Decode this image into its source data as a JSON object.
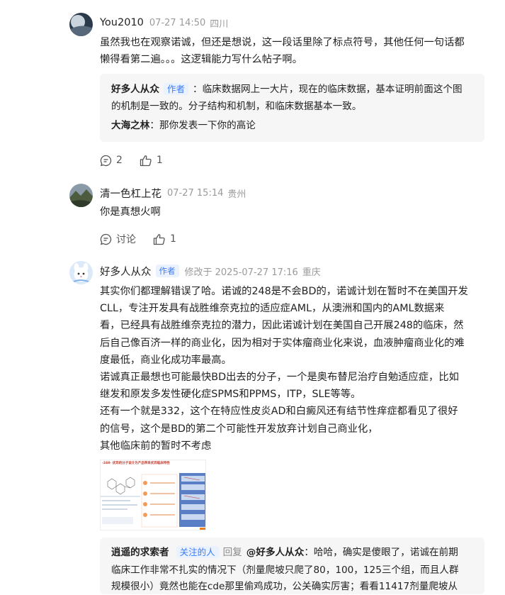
{
  "comments": [
    {
      "username": "You2010",
      "time": "07-27 14:50",
      "location": "四川",
      "text_lines": [
        "虽然我也在观察诺诚，但还是想说，这一段话里除了标点符号，其他任何一句话都",
        "懒得看第二遍。。。这逻辑能力写什么帖子啊。"
      ],
      "replies": [
        {
          "name": "好多人从众",
          "badge": "作者",
          "lines": [
            "：临床数据网上一大片，现在的临床数据，基本证明前面这个图",
            "的机制是一致的。分子结构和机制，和临床数据基本一致。"
          ]
        },
        {
          "name": "大海之林",
          "lines": [
            "：那你发表一下你的高论"
          ]
        }
      ],
      "reply_count": "2",
      "like_count": "1"
    },
    {
      "username": "清一色杠上花",
      "time": "07-27 15:14",
      "location": "贵州",
      "text_lines": [
        "你是真想火啊"
      ],
      "reply_label": "讨论",
      "like_count": "1"
    },
    {
      "username": "好多人从众",
      "badge": "作者",
      "time": "修改于 2025-07-27 17:16",
      "location": "重庆",
      "text_lines": [
        "其实你们都理解错误了哈。诺诚的248是不会BD的，诺诚计划在暂时不在美国开发",
        "CLL，专注开发具有战胜维奈克拉的适应症AML，从澳洲和国内的AML数据来",
        "看，已经具有战胜维奈克拉的潜力，因此诺诚计划在美国自己开展248的临床，然",
        "后自己像百济一样的商业化，因为相对于实体瘤商业化来说，血液肿瘤商业化的难",
        "度最低，商业化成功率最高。",
        "诺诚真正最想也可能最快BD出去的分子，一个是奥布替尼治疗自勉适应症，比如",
        "继发和原发多发性硬化症SPMS和PPMS，ITP，SLE等等。",
        "还有一个就是332，这个在特应性皮炎AD和白癜风还有结节性痒症都看见了很好",
        "的信号，这个是BD的第二个可能性开发放弃计划自己商业化，",
        "其他临床前的暂时不考虑"
      ],
      "image_caption": "-248- 优异的分子设计为产品带来优异临床特性",
      "reply": {
        "name": "逍遥的求索者",
        "follow_label": "关注的人",
        "reply_word": "回复",
        "target": "@好多人从众",
        "lines": [
          "：哈哈，确实是傻眼了，诺诚在前期",
          "临床工作非常不扎实的情况下（剂量爬坡只爬了80，100，125三个组，而且人群",
          "规模很小）竟然也能在cde那里偷鸡成功，公关确实厉害；看看11417剂量爬坡从"
        ]
      }
    }
  ],
  "colors": {
    "meta_gray": "#9a9a9a",
    "badge_blue": "#3d7df6",
    "reply_bg": "#f6f6f7"
  }
}
